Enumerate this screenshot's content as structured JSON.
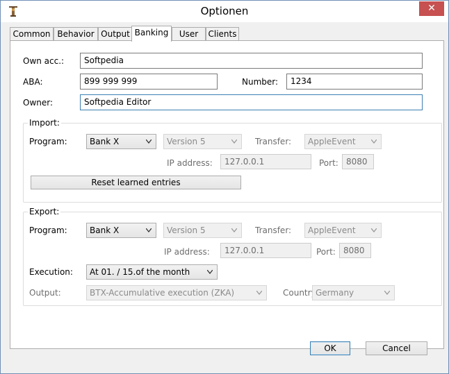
{
  "window": {
    "title": "Optionen",
    "close_glyph": "✕"
  },
  "tabs": [
    "Common",
    "Behavior",
    "Output",
    "Banking",
    "User",
    "Clients"
  ],
  "account": {
    "own_acc_label": "Own acc.:",
    "own_acc_value": "Softpedia",
    "aba_label": "ABA:",
    "aba_value": "899 999 999",
    "number_label": "Number:",
    "number_value": "1234",
    "owner_label": "Owner:",
    "owner_value": "Softpedia Editor"
  },
  "import": {
    "title": "Import:",
    "program_label": "Program:",
    "program_value": "Bank X",
    "version_value": "Version 5",
    "transfer_label": "Transfer:",
    "transfer_value": "AppleEvent",
    "ip_label": "IP address:",
    "ip_value": "127.0.0.1",
    "port_label": "Port:",
    "port_value": "8080",
    "reset_button": "Reset learned entries"
  },
  "export": {
    "title": "Export:",
    "program_label": "Program:",
    "program_value": "Bank X",
    "version_value": "Version 5",
    "transfer_label": "Transfer:",
    "transfer_value": "AppleEvent",
    "ip_label": "IP address:",
    "ip_value": "127.0.0.1",
    "port_label": "Port:",
    "port_value": "8080",
    "execution_label": "Execution:",
    "execution_value": "At 01. / 15.of the month",
    "output_label": "Output:",
    "output_value": "BTX-Accumulative execution (ZKA)",
    "country_label": "Country:",
    "country_value": "Germany"
  },
  "buttons": {
    "ok": "OK",
    "cancel": "Cancel"
  },
  "colors": {
    "close_button": "#c75050",
    "focus_border": "#3c7fb1",
    "disabled_text": "#6d6d6d"
  }
}
